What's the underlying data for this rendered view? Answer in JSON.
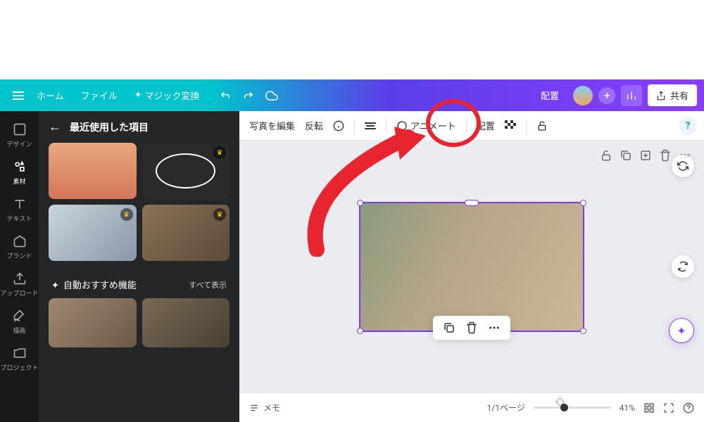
{
  "topbar": {
    "home": "ホーム",
    "file": "ファイル",
    "magic": "マジック変換",
    "arrange": "配置",
    "share": "共有"
  },
  "rail": [
    {
      "key": "design",
      "label": "デザイン"
    },
    {
      "key": "elements",
      "label": "素材"
    },
    {
      "key": "text",
      "label": "テキスト"
    },
    {
      "key": "brand",
      "label": "ブランド"
    },
    {
      "key": "upload",
      "label": "アップロード"
    },
    {
      "key": "draw",
      "label": "描画"
    },
    {
      "key": "projects",
      "label": "プロジェクト"
    }
  ],
  "sidebar": {
    "recent_title": "最近使用した項目",
    "auto_rec": "自動おすすめ機能",
    "show_all": "すべて表示"
  },
  "canvas_toolbar": {
    "edit_photo": "写真を編集",
    "flip": "反転",
    "animate": "アニメート",
    "position": "配置"
  },
  "bottom": {
    "notes": "メモ",
    "page": "1/1ページ",
    "zoom": "41%"
  },
  "annotation": {
    "target": "position-button"
  }
}
